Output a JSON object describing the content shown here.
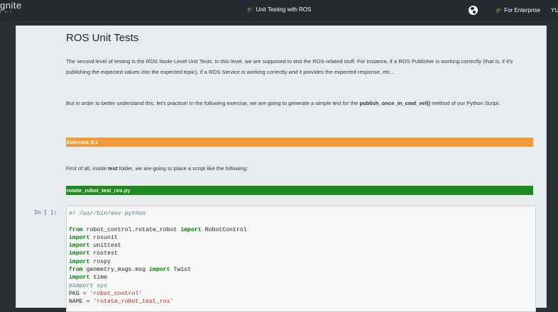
{
  "topbar": {
    "brand_main": "gnite",
    "brand_sub": "EMY",
    "title": "Unit Testing with ROS",
    "enterprise_label": "For Enterprise",
    "user_initial": "YU"
  },
  "icons": {
    "title_icon": "graduation-cap-icon",
    "enterprise_icon": "graduation-cap-icon",
    "language_icon": "globe-icon"
  },
  "notebook": {
    "heading": "ROS Unit Tests",
    "para1": "The second level of testing is the ROS Node-Level Unit Tests. In this level, we are supposed to test the ROS-related stuff. For instance, if a ROS Publisher is working correctly (that is, if it's publishing the expected values into the expected topic), if a ROS Service is working correctly and it provides the expected response, etc...",
    "para2_before": "But in order to better understand this, let's practice! In the following exercise, we are going to generate a simple test for the ",
    "para2_bold": "publish_once_in_cmd_vel()",
    "para2_after": " method of our Python Script.",
    "exercise_label": "Exercise 3.1",
    "para3_before": "First of all, inside ",
    "para3_bold": "test",
    "para3_after": " folder, we are going to place a script like the following:",
    "file_label": "rotate_robot_test_ros.py",
    "prompt": "In [ ]:",
    "code": {
      "line1": "#! /usr/bin/env python",
      "line2_kw1": "from",
      "line2_mod": " robot_control.rotate_robot ",
      "line2_kw2": "import",
      "line2_name": " RobotControl",
      "line3_kw": "import",
      "line3_name": " rosunit",
      "line4_kw": "import",
      "line4_name": " unittest",
      "line5_kw": "import",
      "line5_name": " rostest",
      "line6_kw": "import",
      "line6_name": " rospy",
      "line7_kw1": "from",
      "line7_mod": " geometry_msgs.msg ",
      "line7_kw2": "import",
      "line7_name": " Twist",
      "line8_kw": "import",
      "line8_name": " time",
      "line9": "#import sys",
      "line10_var": "PKG = ",
      "line10_str": "'robot_control'",
      "line11_var": "NAME = ",
      "line11_str": "'rotate_robot_test_ros'"
    }
  },
  "colors": {
    "exercise_bar": "#f29a36",
    "file_bar": "#1f8a1f",
    "topbar": "#26292e"
  }
}
